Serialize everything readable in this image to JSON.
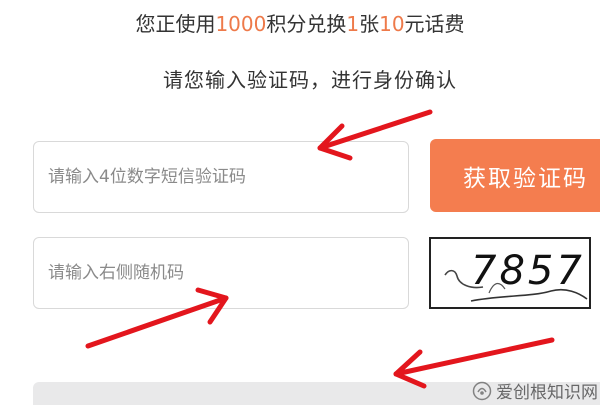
{
  "header": {
    "prefix": "您正使用",
    "points": "1000",
    "middle1": "积分兑换",
    "count": "1",
    "middle2": "张",
    "value": "10",
    "suffix": "元话费"
  },
  "instruction": "请您输入验证码，进行身份确认",
  "sms_field": {
    "placeholder": "请输入4位数字短信验证码",
    "value": ""
  },
  "sms_button": {
    "label": "获取验证码"
  },
  "captcha_field": {
    "placeholder": "请输入右侧随机码",
    "value": ""
  },
  "captcha": {
    "code": "7857"
  },
  "watermark": {
    "text": "爱创根知识网"
  },
  "colors": {
    "accent": "#f47d4f",
    "highlight_text": "#ee7a4a",
    "annotation_arrow": "#e3161d",
    "submit_bar": "#e9e9ea"
  },
  "icons": [
    "watermark-logo-icon",
    "annotation-arrow-icon"
  ]
}
